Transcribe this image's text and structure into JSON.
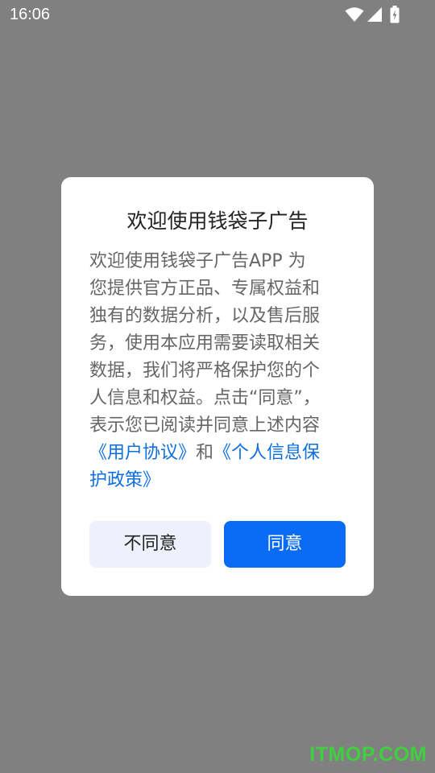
{
  "status_bar": {
    "time": "16:06",
    "icons": [
      "wifi-icon",
      "signal-icon",
      "battery-icon"
    ]
  },
  "dialog": {
    "title": "欢迎使用钱袋子广告",
    "body_lines": [
      "欢迎使用钱袋子广告APP 为",
      "您提供官方正品、专属权益和",
      "独有的数据分析，以及售后服",
      "务，使用本应用需要读取相关",
      "数据，我们将严格保护您的个",
      "人信息和权益。点击“同意”，",
      "表示您已阅读并同意上述内容"
    ],
    "user_agreement_link": "《用户协议》",
    "conjunction": "和",
    "privacy_link_part1": "《个人信息保",
    "privacy_link_part2": "护政策》",
    "disagree_label": "不同意",
    "agree_label": "同意"
  },
  "watermark": "ITMOP.COM",
  "colors": {
    "overlay": "#808080",
    "primary": "#0a6cf5",
    "link": "#0f6fe0",
    "secondary_button": "#eef1fb",
    "watermark": "#3fcf3f"
  }
}
